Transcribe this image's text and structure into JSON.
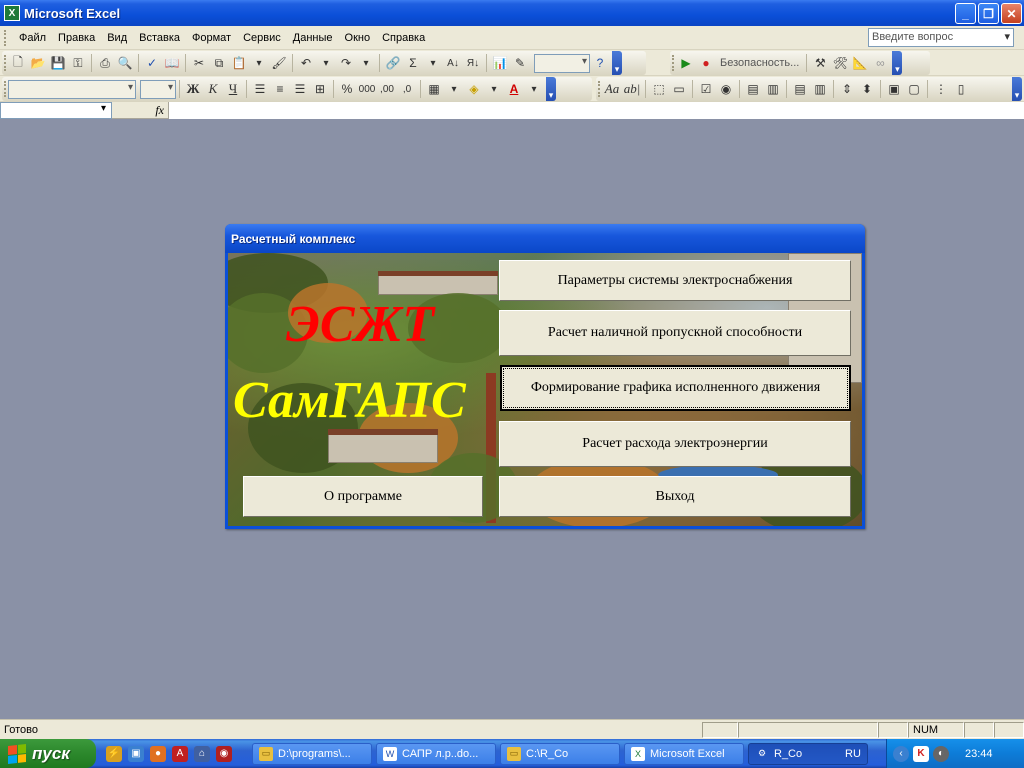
{
  "window": {
    "title": "Microsoft Excel",
    "app_icon": "X",
    "minimize": "_",
    "restore": "❐",
    "close": "✕"
  },
  "menu": {
    "items": [
      "Файл",
      "Правка",
      "Вид",
      "Вставка",
      "Формат",
      "Сервис",
      "Данные",
      "Окно",
      "Справка"
    ],
    "ask_placeholder": "Введите вопрос"
  },
  "toolbar": {
    "security_label": "Безопасность...",
    "bold": "Ж",
    "italic": "К",
    "underline": "Ч",
    "percent": "%",
    "thousands": "000",
    "inc_decimal": ",00",
    "dec_decimal": ",0",
    "font_color_glyph": "A"
  },
  "formula_bar": {
    "fx_label": "fx"
  },
  "dialog": {
    "title": "Расчетный комплекс",
    "logo_line1": "ЭСЖТ",
    "logo_line2": "СамГАПС",
    "buttons": {
      "params": "Параметры системы электроснабжения",
      "capacity": "Расчет наличной пропускной способности",
      "schedule": "Формирование графика исполненного движения",
      "energy": "Расчет расхода электроэнергии",
      "about": "О программе",
      "exit": "Выход"
    }
  },
  "status_bar": {
    "ready": "Готово",
    "num": "NUM"
  },
  "taskbar": {
    "start": "пуск",
    "tasks": [
      {
        "label": "D:\\programs\\...",
        "icon": "folder-icon"
      },
      {
        "label": "САПР л.р..do...",
        "icon": "word-icon"
      },
      {
        "label": "C:\\R_Co",
        "icon": "folder-icon"
      },
      {
        "label": "Microsoft Excel",
        "icon": "excel-icon"
      },
      {
        "label": "R_Co",
        "icon": "gear-icon"
      }
    ],
    "lang": "RU",
    "clock": "23:44"
  },
  "colors": {
    "titlebar": "#0b4fd8",
    "workspace": "#8a91a6",
    "logo_red": "#ff0000",
    "logo_yellow": "#ffff00",
    "button_face": "#ece9d8"
  }
}
